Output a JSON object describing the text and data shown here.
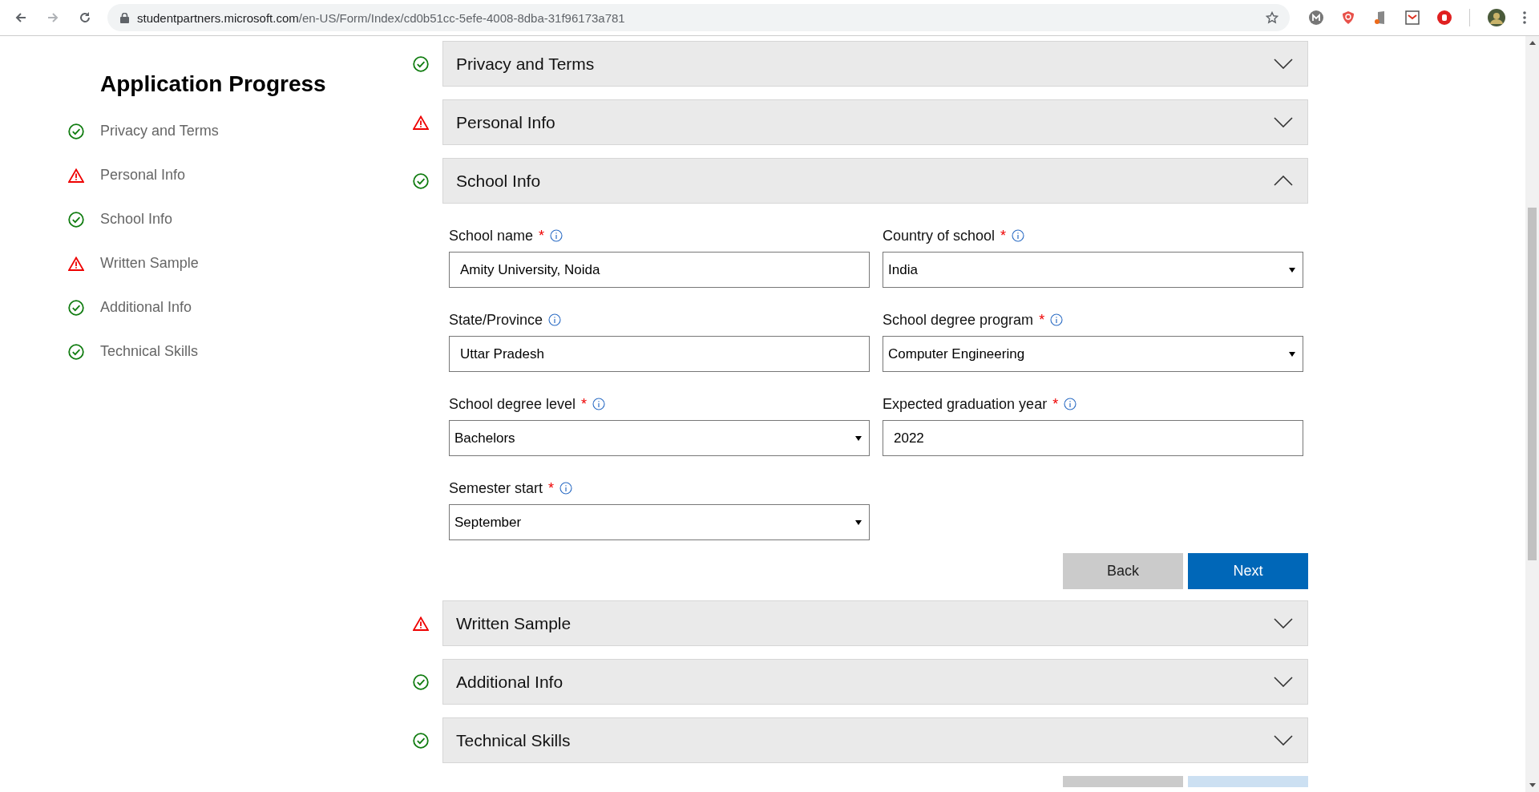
{
  "browser": {
    "url_host": "studentpartners.microsoft.com",
    "url_path": "/en-US/Form/Index/cd0b51cc-5efe-4008-8dba-31f96173a781"
  },
  "sidebar": {
    "title": "Application Progress",
    "items": [
      {
        "label": "Privacy and Terms",
        "complete": true
      },
      {
        "label": "Personal Info",
        "complete": false
      },
      {
        "label": "School Info",
        "complete": true
      },
      {
        "label": "Written Sample",
        "complete": false
      },
      {
        "label": "Additional Info",
        "complete": true
      },
      {
        "label": "Technical Skills",
        "complete": true
      }
    ]
  },
  "sections": [
    {
      "title": "Privacy and Terms",
      "complete": true,
      "expanded": false
    },
    {
      "title": "Personal Info",
      "complete": false,
      "expanded": false
    },
    {
      "title": "School Info",
      "complete": true,
      "expanded": true,
      "fields": [
        {
          "label": "School name",
          "required_mark": "*",
          "kind": "text",
          "value": "Amity University, Noida"
        },
        {
          "label": "Country of school",
          "required_mark": "*",
          "kind": "select",
          "value": "India"
        },
        {
          "label": "State/Province",
          "kind": "text",
          "value": "Uttar Pradesh"
        },
        {
          "label": "School degree program",
          "required_mark": "*",
          "kind": "select",
          "value": "Computer Engineering"
        },
        {
          "label": "School degree level",
          "required_mark": "*",
          "kind": "select",
          "value": "Bachelors"
        },
        {
          "label": "Expected graduation year",
          "required_mark": "*",
          "kind": "text",
          "value": "2022"
        },
        {
          "label": "Semester start",
          "required_mark": "*",
          "kind": "select",
          "value": "September"
        }
      ],
      "buttons": [
        {
          "label": "Back",
          "kind": "secondary"
        },
        {
          "label": "Next",
          "kind": "primary"
        }
      ]
    },
    {
      "title": "Written Sample",
      "complete": false,
      "expanded": false
    },
    {
      "title": "Additional Info",
      "complete": true,
      "expanded": false
    },
    {
      "title": "Technical Skills",
      "complete": true,
      "expanded": false
    }
  ]
}
